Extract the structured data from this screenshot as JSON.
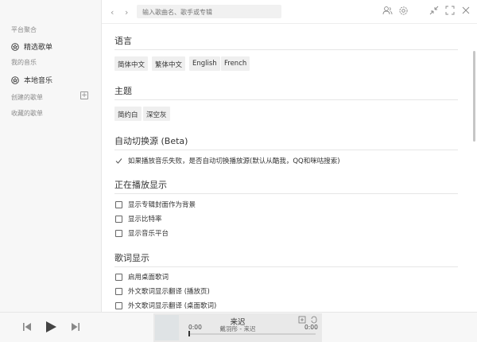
{
  "sidebar": {
    "section_platform": "平台聚合",
    "item_selected": "精选歌单",
    "section_mine": "我的音乐",
    "item_local": "本地音乐",
    "section_created": "创建的歌单",
    "section_collected": "收藏的歌单",
    "add_symbol": "+"
  },
  "topbar": {
    "back": "‹",
    "forward": "›",
    "search_placeholder": "输入歌曲名、歌手或专辑"
  },
  "settings": {
    "language": {
      "title": "语言",
      "options": [
        "简体中文",
        "繁体中文",
        "English",
        "French"
      ]
    },
    "theme": {
      "title": "主题",
      "options": [
        "简约白",
        "深空灰"
      ]
    },
    "autoswitch": {
      "title": "自动切换源 (Beta)",
      "option": "如果播放音乐失败，是否自动切换播放源(默认从酷我，QQ和咪咕搜索)",
      "checked": true
    },
    "playing": {
      "title": "正在播放显示",
      "options": [
        "显示专辑封面作为背景",
        "显示比特率",
        "显示音乐平台"
      ]
    },
    "lyrics": {
      "title": "歌词显示",
      "options": [
        "启用桌面歌词",
        "外文歌词显示翻译 (播放页)",
        "外文歌词显示翻译 (桌面歌词)"
      ]
    }
  },
  "player": {
    "title": "来迟",
    "artist": "戴羽彤 - 来迟",
    "time_current": "0:00",
    "time_total": "0:00",
    "progress": 0
  }
}
